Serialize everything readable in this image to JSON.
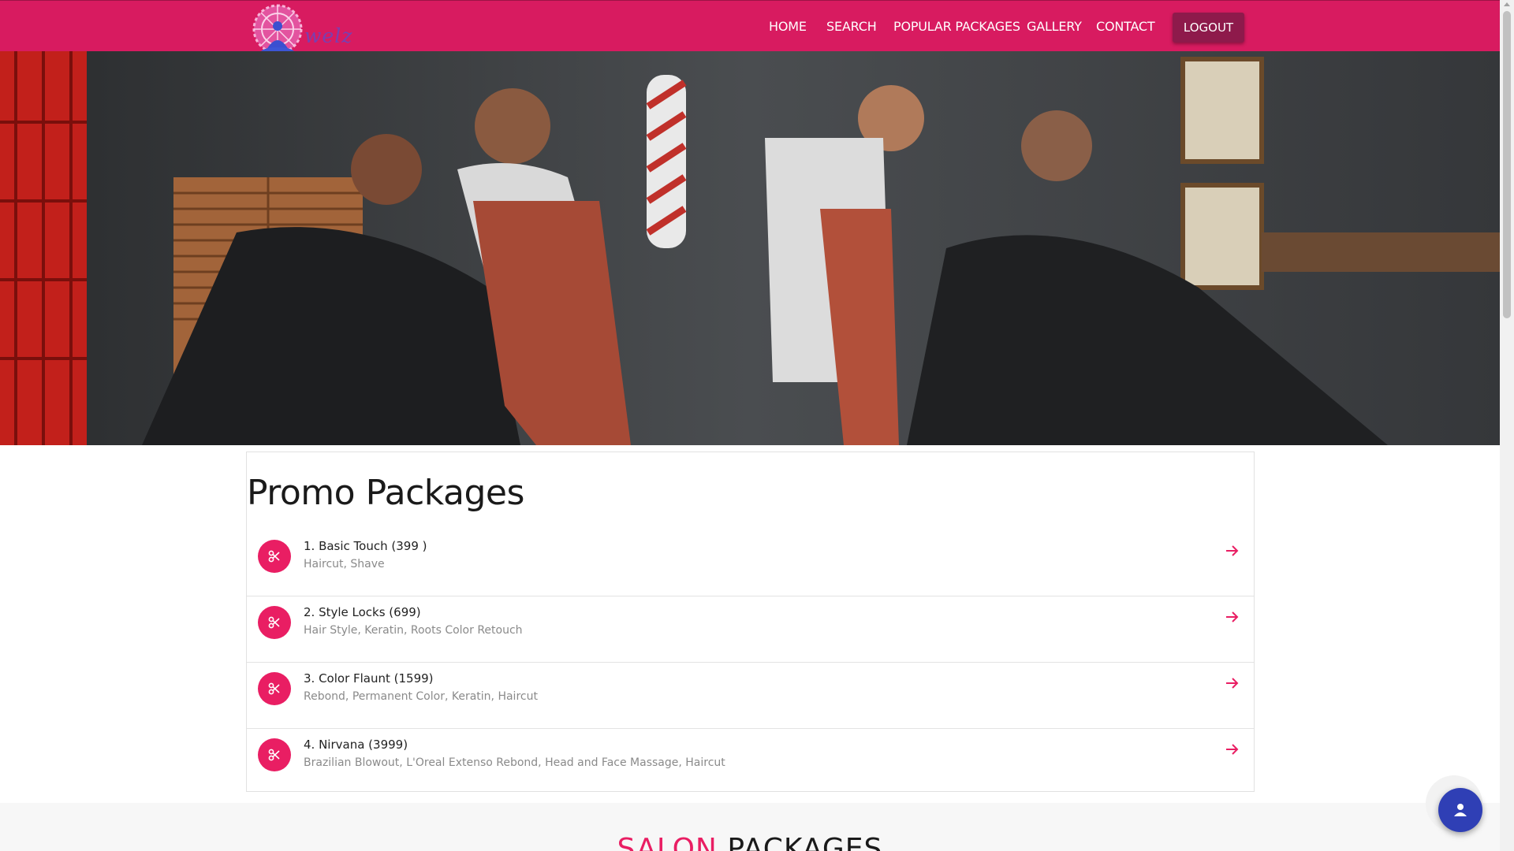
{
  "brand": {
    "logo_text": "welz"
  },
  "nav": {
    "items": [
      "HOME",
      "SEARCH",
      "POPULAR PACKAGES",
      "GALLERY",
      "CONTACT"
    ],
    "logout_label": "LOGOUT"
  },
  "promo": {
    "title": "Promo Packages",
    "packages": [
      {
        "name": "1. Basic Touch (399 )",
        "services": "Haircut, Shave"
      },
      {
        "name": "2. Style Locks (699)",
        "services": "Hair Style, Keratin, Roots Color Retouch"
      },
      {
        "name": "3. Color Flaunt (1599)",
        "services": "Rebond, Permanent Color, Keratin, Haircut"
      },
      {
        "name": "4. Nirvana (3999)",
        "services": "Brazilian Blowout, L'Oreal Extenso Rebond, Head and Face Massage, Haircut"
      }
    ]
  },
  "salon": {
    "title_accent": "SALON",
    "title_rest": "PACKAGES"
  },
  "colors": {
    "brand_pink": "#d81b60",
    "accent_pink": "#e91e63",
    "logout_bg": "#8e1a4b",
    "fab_blue": "#2f3fb5"
  },
  "icons": {
    "package_icon": "scissors-icon",
    "row_action": "arrow-right-icon",
    "fab": "user-icon"
  }
}
